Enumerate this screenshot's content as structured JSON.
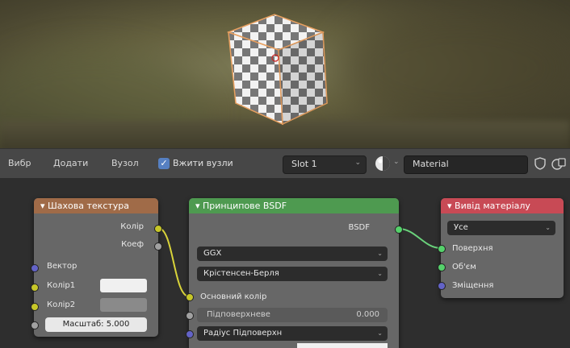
{
  "header": {
    "menu": [
      "Вибр",
      "Додати",
      "Вузол"
    ],
    "use_nodes_label": "Вжити вузли",
    "slot": "Slot 1",
    "material": "Material"
  },
  "nodes": {
    "checker": {
      "title": "Шахова текстура",
      "out_color": "Колір",
      "out_fac": "Коеф",
      "in_vector": "Вектор",
      "in_color1": "Колір1",
      "in_color2": "Колір2",
      "scale_label": "Масштаб:",
      "scale_value": "5.000"
    },
    "bsdf": {
      "title": "Принципове BSDF",
      "out_bsdf": "BSDF",
      "distribution": "GGX",
      "subsurface_method": "Крістенсен-Берля",
      "base_color": "Основний колір",
      "subsurface": "Підповерхневе",
      "subsurface_value": "0.000",
      "subsurface_radius": "Радіус Підповерхн"
    },
    "output": {
      "title": "Вивід матеріалу",
      "target": "Усе",
      "surface": "Поверхня",
      "volume": "Об'єм",
      "displacement": "Зміщення"
    }
  },
  "colors": {
    "checker_header": "#a06b48",
    "bsdf_header": "#4e9a50",
    "output_header": "#c84a55",
    "shader_socket": "#55d16b",
    "color_socket": "#c7c729",
    "vector_socket": "#6363c7",
    "float_socket": "#a1a1a1",
    "use_nodes_check": "#5680c2"
  }
}
